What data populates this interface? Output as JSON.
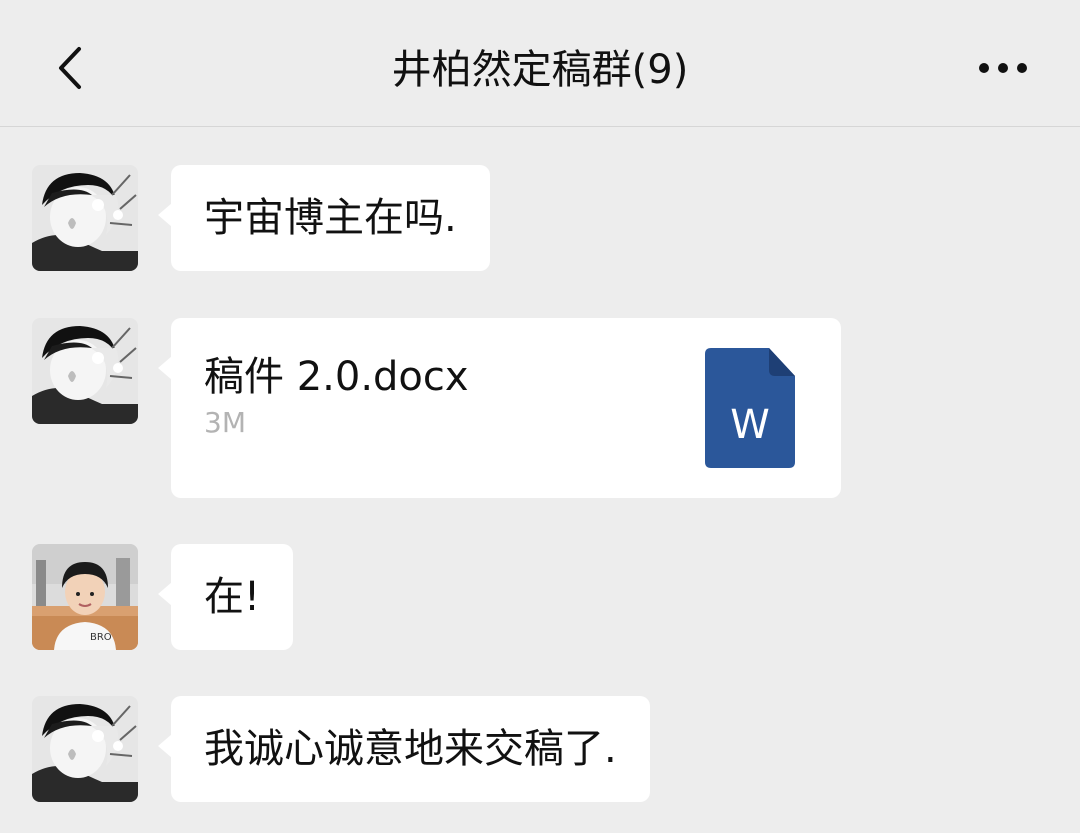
{
  "header": {
    "title": "井柏然定稿群(9)",
    "back_icon": "chevron-left-icon",
    "more_icon": "more-dots-icon"
  },
  "messages": [
    {
      "type": "text",
      "sender_avatar": "avatar-bw",
      "text": "宇宙博主在吗."
    },
    {
      "type": "file",
      "sender_avatar": "avatar-bw",
      "file_name": "稿件 2.0.docx",
      "file_size": "3M",
      "file_icon": "word-doc-icon",
      "file_icon_letter": "W"
    },
    {
      "type": "text",
      "sender_avatar": "avatar-color",
      "text": "在!"
    },
    {
      "type": "text",
      "sender_avatar": "avatar-bw",
      "text": "我诚心诚意地来交稿了."
    }
  ],
  "colors": {
    "background": "#ededed",
    "bubble": "#ffffff",
    "word_icon": "#2b579a"
  }
}
